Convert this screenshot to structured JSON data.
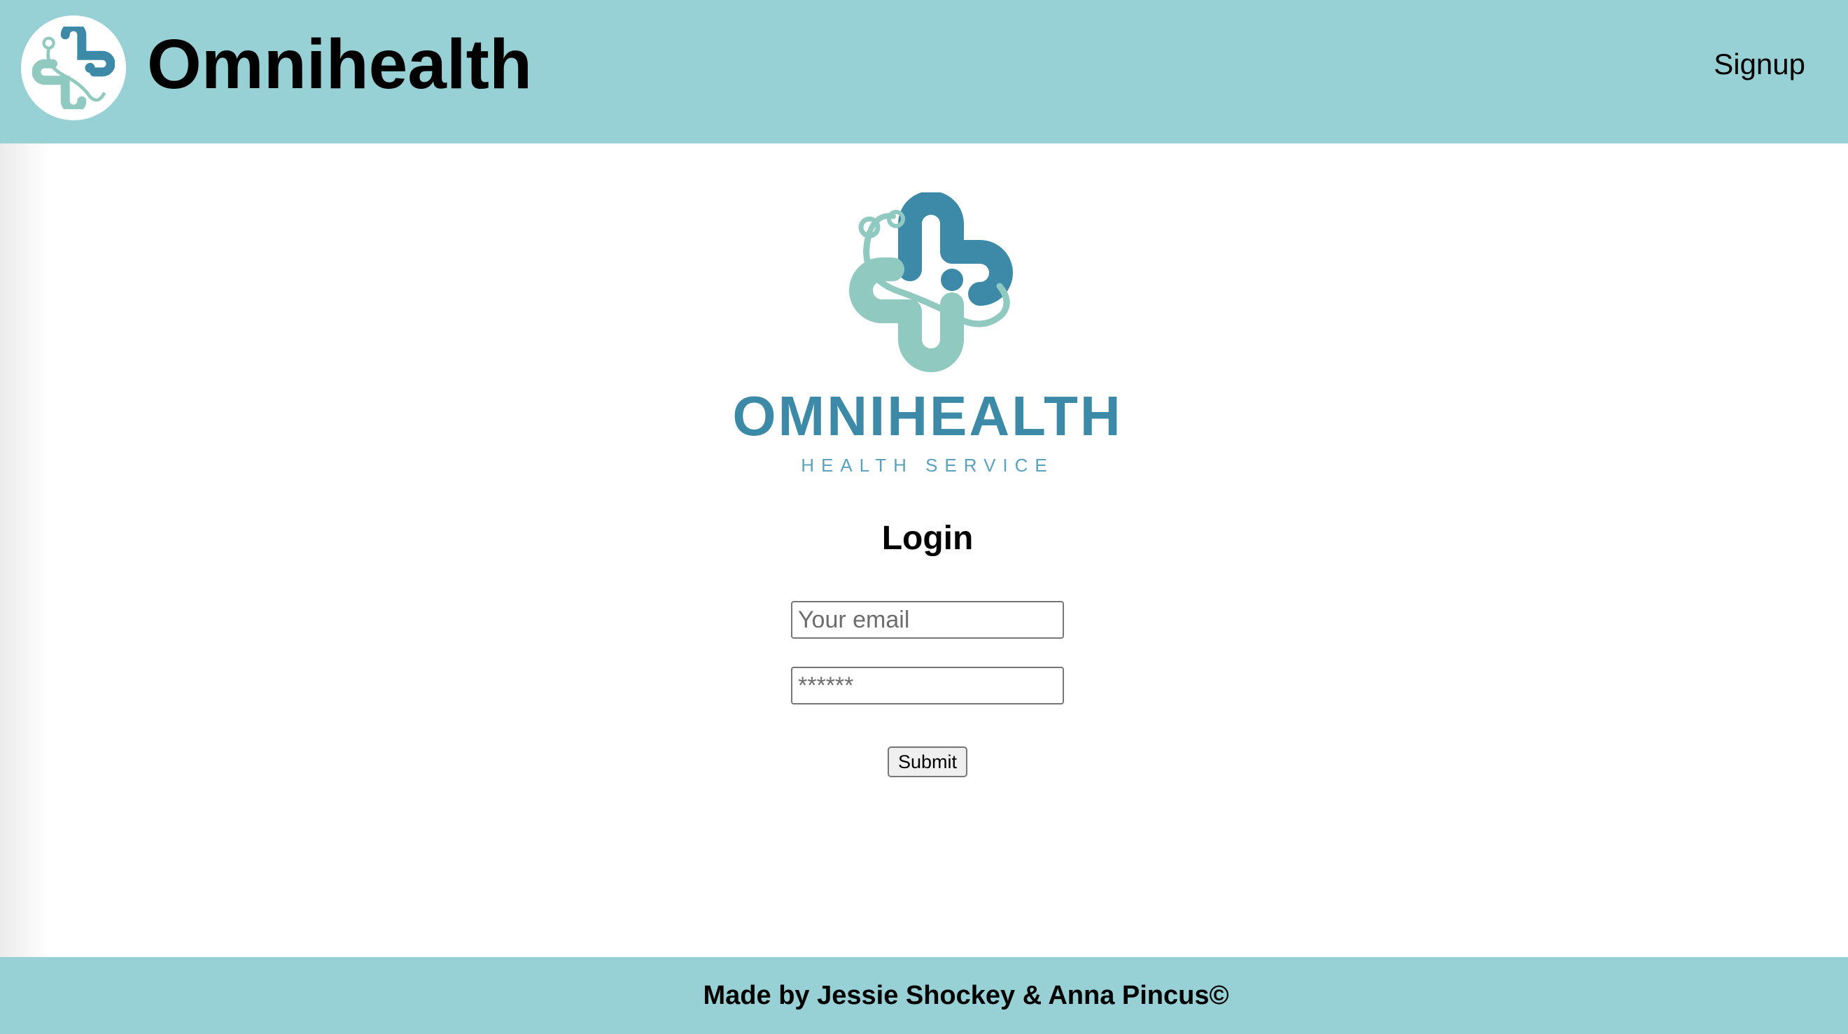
{
  "header": {
    "title": "Omnihealth",
    "signup_label": "Signup"
  },
  "brand": {
    "name": "OMNIHEALTH",
    "tagline": "HEALTH SERVICE",
    "colors": {
      "dark_teal": "#3d8aa8",
      "light_teal": "#8fc9bf",
      "header_bg": "#97d0d5"
    },
    "icon": "medical-cross-stethoscope-icon"
  },
  "login": {
    "title": "Login",
    "email_placeholder": "Your email",
    "password_placeholder": "******",
    "submit_label": "Submit"
  },
  "footer": {
    "credit": "Made by Jessie Shockey & Anna Pincus©"
  }
}
